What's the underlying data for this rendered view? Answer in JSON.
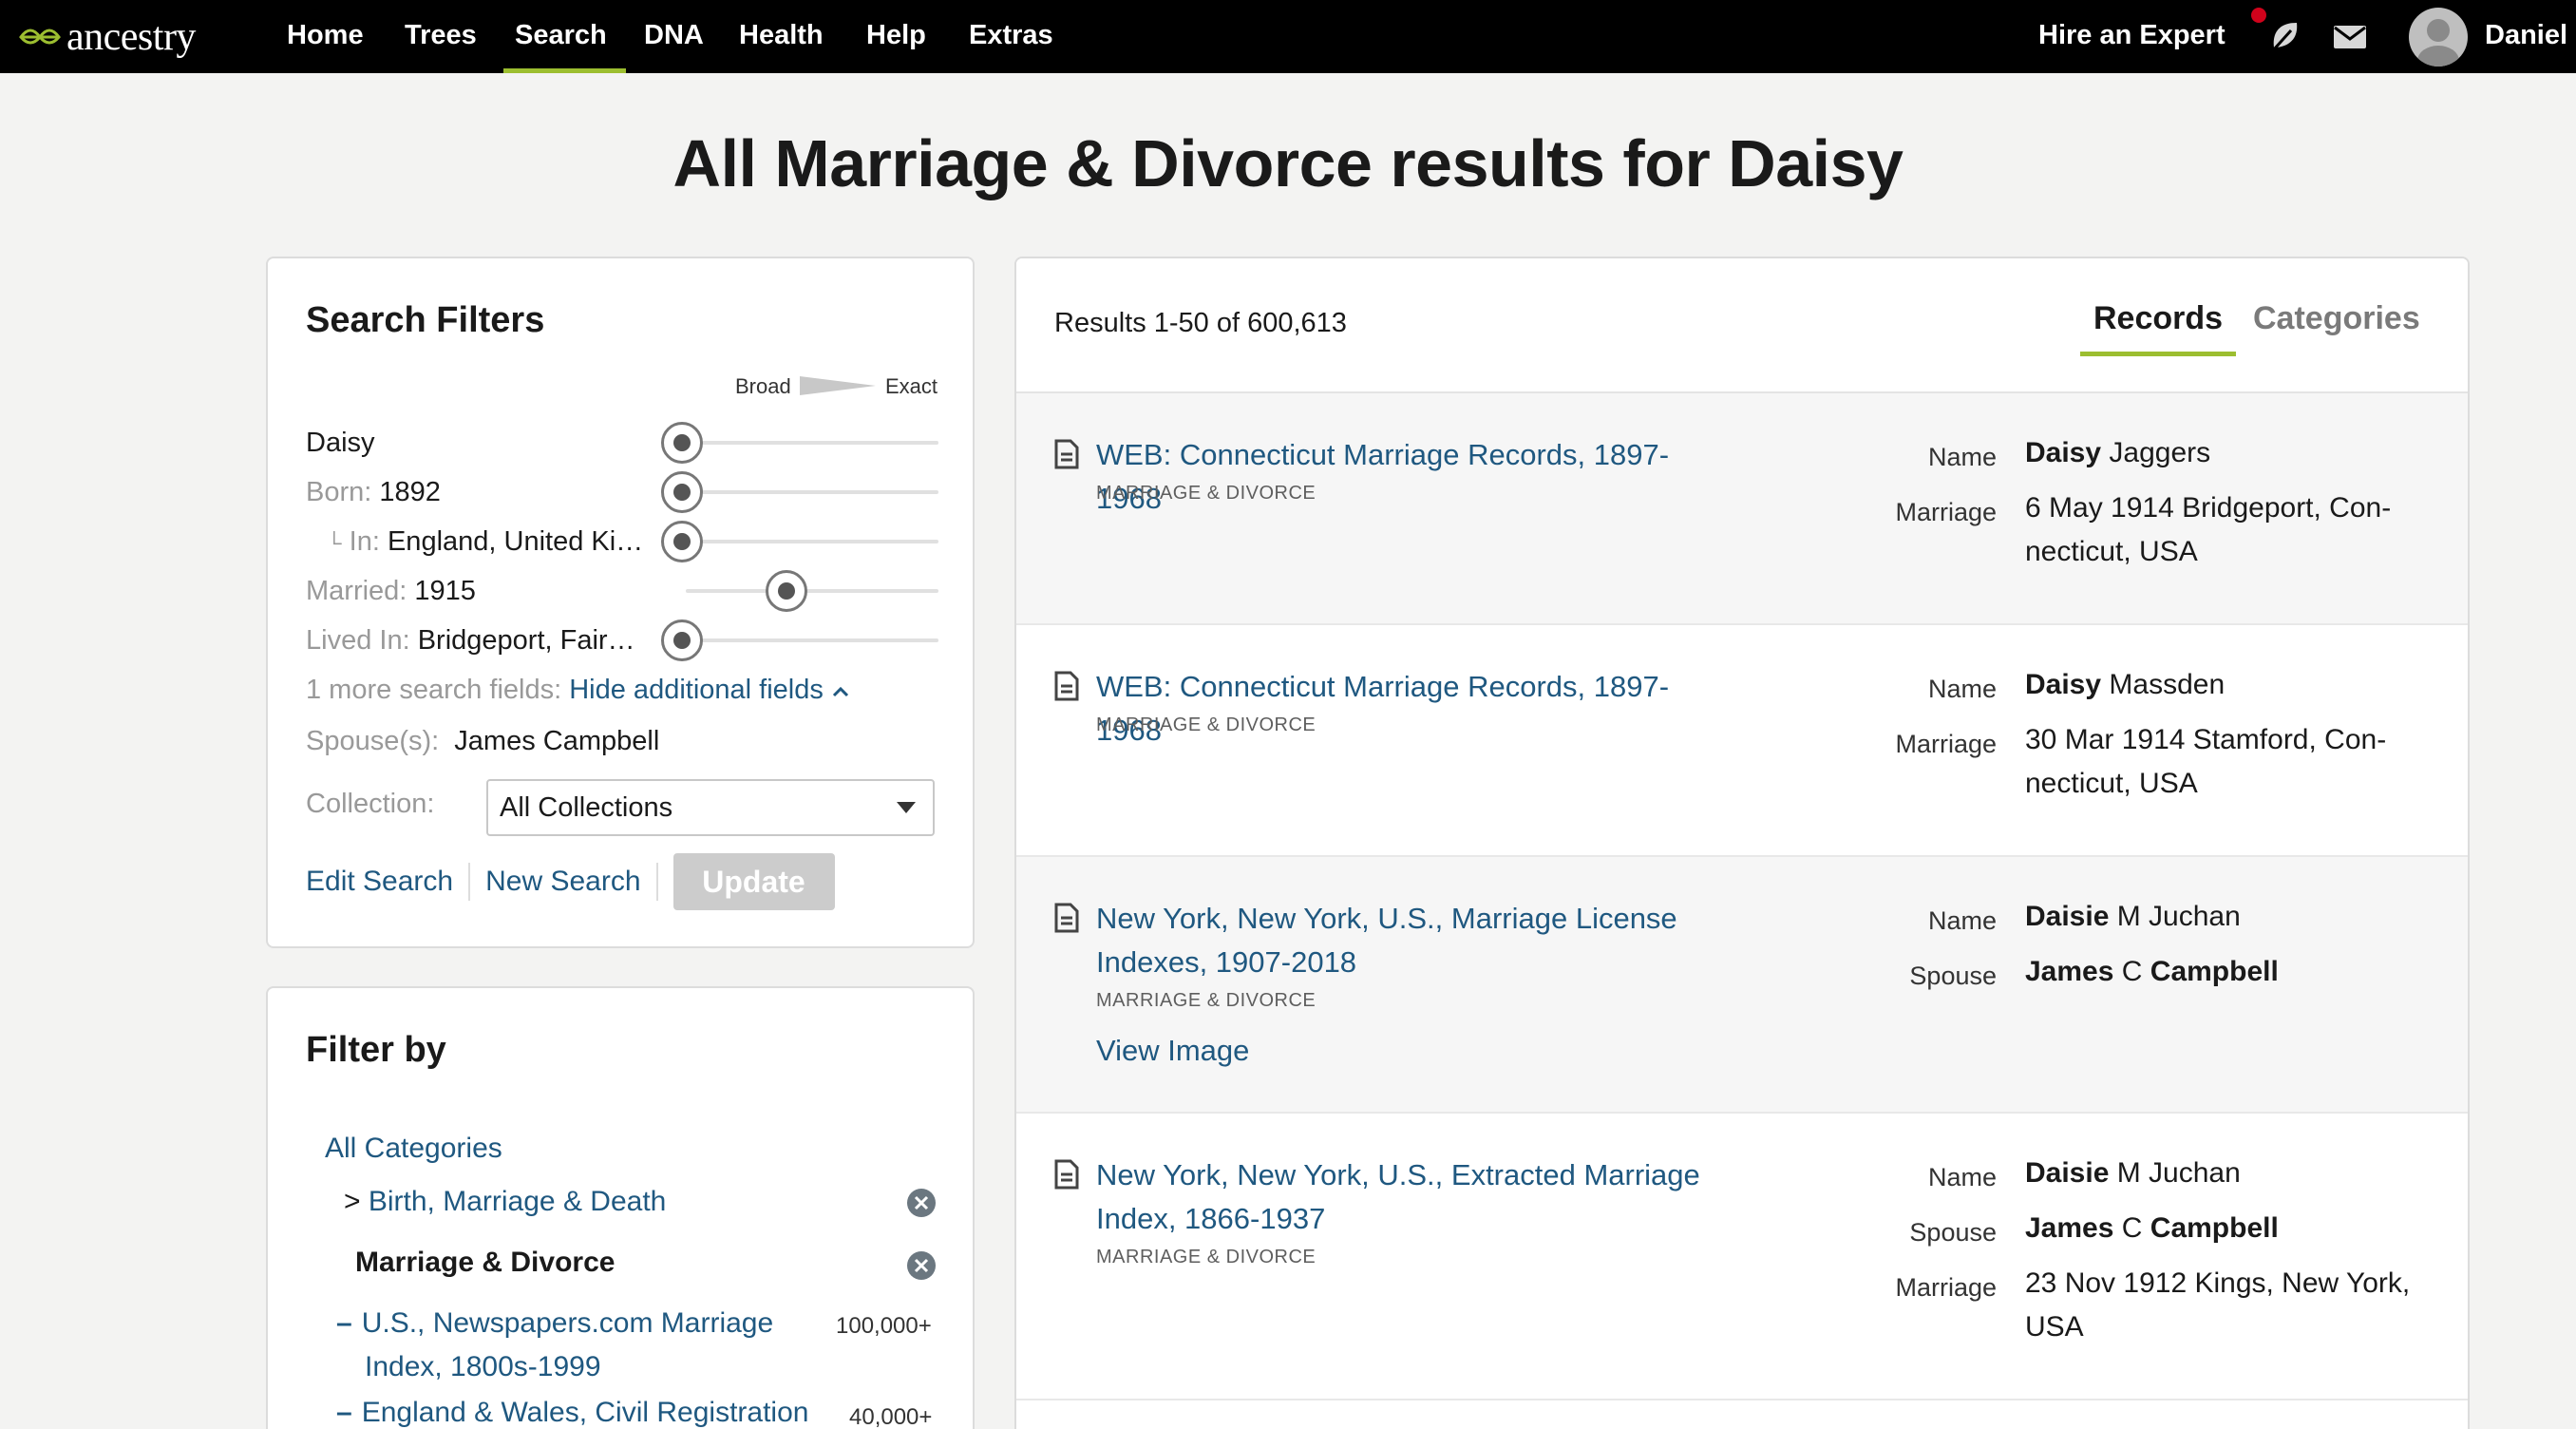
{
  "nav": {
    "logo": "ancestry",
    "items": [
      "Home",
      "Trees",
      "Search",
      "DNA",
      "Health",
      "Help",
      "Extras"
    ],
    "active": "Search",
    "hire": "Hire an Expert",
    "user": "Daniel"
  },
  "page_title": "All Marriage & Divorce results for Daisy",
  "search_filters": {
    "heading": "Search Filters",
    "broad": "Broad",
    "exact": "Exact",
    "name": "Daisy",
    "born_label": "Born:",
    "born_value": "1892",
    "in_label": "In:",
    "in_value": "England, United Ki…",
    "married_label": "Married:",
    "married_value": "1915",
    "lived_label": "Lived In:",
    "lived_value": "Bridgeport, Fair…",
    "more_fields": "1 more search fields:",
    "hide_link": "Hide additional fields",
    "spouse_label": "Spouse(s):",
    "spouse_value": "James Campbell",
    "collection_label": "Collection:",
    "collection_value": "All Collections",
    "edit_search": "Edit Search",
    "new_search": "New Search",
    "update": "Update"
  },
  "filter_by": {
    "heading": "Filter by",
    "all_categories": "All Categories",
    "birth_marriage_death": "Birth, Marriage & Death",
    "marriage_divorce": "Marriage & Divorce",
    "collections": [
      {
        "name_line1": "U.S., Newspapers.com Marriage",
        "name_line2": "Index, 1800s-1999",
        "count": "100,000+"
      },
      {
        "name_line1": "England & Wales, Civil Registration",
        "count": "40,000+"
      }
    ]
  },
  "results": {
    "count_text": "Results 1-50 of 600,613",
    "tabs": {
      "records": "Records",
      "categories": "Categories"
    },
    "records": [
      {
        "title_line1": "WEB: Connecticut Marriage Records, 1897-1968",
        "category": "MARRIAGE & DIVORCE",
        "name_label": "Name",
        "name_first": "Daisy",
        "name_rest": "Jaggers",
        "marriage_label": "Marriage",
        "marriage_line1": "6 May 1914 Bridgeport, Con-",
        "marriage_line2": "necticut, USA"
      },
      {
        "title_line1": "WEB: Connecticut Marriage Records, 1897-1968",
        "category": "MARRIAGE & DIVORCE",
        "name_label": "Name",
        "name_first": "Daisy",
        "name_rest": "Massden",
        "marriage_label": "Marriage",
        "marriage_line1": "30 Mar 1914 Stamford, Con-",
        "marriage_line2": "necticut, USA"
      },
      {
        "title_line1": "New York, New York, U.S., Marriage License",
        "title_line2": "Indexes, 1907-2018",
        "category": "MARRIAGE & DIVORCE",
        "view_image": "View Image",
        "name_label": "Name",
        "name_first": "Daisie",
        "name_rest": "M Juchan",
        "spouse_label": "Spouse",
        "spouse_first": "James",
        "spouse_mid": "C",
        "spouse_last": "Campbell"
      },
      {
        "title_line1": "New York, New York, U.S., Extracted Marriage",
        "title_line2": "Index, 1866-1937",
        "category": "MARRIAGE & DIVORCE",
        "name_label": "Name",
        "name_first": "Daisie",
        "name_rest": "M Juchan",
        "spouse_label": "Spouse",
        "spouse_first": "James",
        "spouse_mid": "C",
        "spouse_last": "Campbell",
        "marriage_label": "Marriage",
        "marriage_line1": "23 Nov 1912 Kings, New York,",
        "marriage_line2": "USA"
      }
    ]
  },
  "colors": {
    "accent": "#9cbe30",
    "link": "#1f5880",
    "nav_bg": "#000000",
    "notification": "#d0021b"
  }
}
